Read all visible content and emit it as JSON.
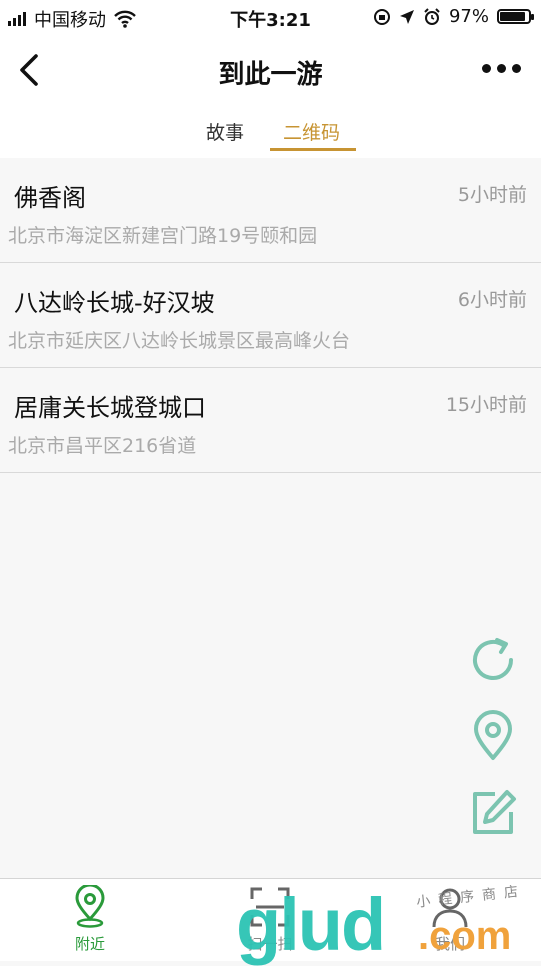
{
  "status_bar": {
    "carrier": "中国移动",
    "time": "下午3:21",
    "battery_percent": "97%",
    "battery_level": 0.97
  },
  "nav": {
    "title": "到此一游",
    "back_icon": "chevron-left-icon",
    "more_icon": "more-dots-icon"
  },
  "tabs": [
    {
      "label": "故事",
      "active": false
    },
    {
      "label": "二维码",
      "active": true
    }
  ],
  "accent_color": "#c79433",
  "list": [
    {
      "name": "佛香阁",
      "time": "5小时前",
      "address": "北京市海淀区新建宫门路19号颐和园"
    },
    {
      "name": "八达岭长城-好汉坡",
      "time": "6小时前",
      "address": "北京市延庆区八达岭长城景区最高峰火台"
    },
    {
      "name": "居庸关长城登城口",
      "time": "15小时前",
      "address": "北京市昌平区216省道"
    }
  ],
  "floating_actions": [
    "refresh-icon",
    "location-pin-icon",
    "edit-icon"
  ],
  "floating_color": "#7cc4b0",
  "tabbar": [
    {
      "label": "附近",
      "icon": "location-pin-icon",
      "active": true
    },
    {
      "label": "扫一扫",
      "icon": "scan-icon",
      "active": false
    },
    {
      "label": "我们",
      "icon": "person-icon",
      "active": false
    }
  ],
  "watermark": {
    "main": "glud",
    "suffix": ".com",
    "small": "小程序商店"
  }
}
